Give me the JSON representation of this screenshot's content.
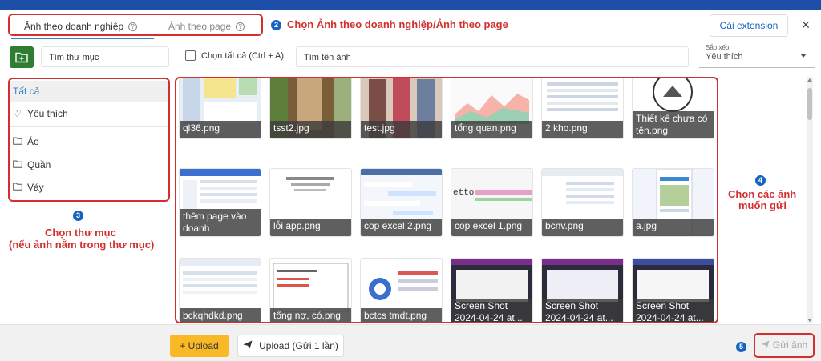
{
  "header": {
    "tabs": [
      "Ảnh theo doanh nghiệp",
      "Ảnh theo page"
    ],
    "extension_button": "Cài extension",
    "close_icon": "×"
  },
  "toolbar": {
    "folder_search_value": "Tìm thư mục",
    "select_all_label": "Chọn tất cả (Ctrl + A)",
    "image_search_value": "Tìm tên ảnh",
    "sort_label": "Sắp xếp",
    "sort_value": "Yêu thích"
  },
  "sidebar": {
    "items": [
      {
        "label": "Tất cả",
        "icon": ""
      },
      {
        "label": "Yêu thích",
        "icon": "♡"
      },
      {
        "label": "Áo",
        "icon": "folder"
      },
      {
        "label": "Quần",
        "icon": "folder"
      },
      {
        "label": "Váy",
        "icon": "folder"
      }
    ]
  },
  "images": [
    "ql36.png",
    "tsst2.jpg",
    "test.jpg",
    "tổng quan.png",
    "2 kho.png",
    "Thiết kế chưa có tên.png",
    "thêm page vào doanh nghiệp.png",
    "lỗi app.png",
    "cop excel 2.png",
    "cop excel 1.png",
    "bcnv.png",
    "a.jpg",
    "bckqhdkd.png",
    "tổng nợ, có.png",
    "bctcs tmdt.png",
    "Screen Shot 2024-04-24 at...",
    "Screen Shot 2024-04-24 at...",
    "Screen Shot 2024-04-24 at..."
  ],
  "annotations": {
    "step2": "2",
    "step2_text": "Chọn Ảnh theo doanh nghiệp/Ảnh theo page",
    "step3": "3",
    "step3_line1": "Chọn thư mục",
    "step3_line2": "(nếu ảnh nằm trong thư mục)",
    "step4": "4",
    "step4_line1": "Chọn các ảnh",
    "step4_line2": "muốn gửi",
    "step5": "5"
  },
  "footer": {
    "upload_label": "+ Upload",
    "upload_once_label": "Upload (Gửi 1 lần)",
    "send_label": "Gửi ảnh"
  },
  "colors": {
    "topbar": "#1e4fa8",
    "annotation_red": "#d32f2f",
    "accent_blue": "#3b82c4",
    "upload_yellow": "#f9b825",
    "folder_green": "#2e7d32"
  }
}
